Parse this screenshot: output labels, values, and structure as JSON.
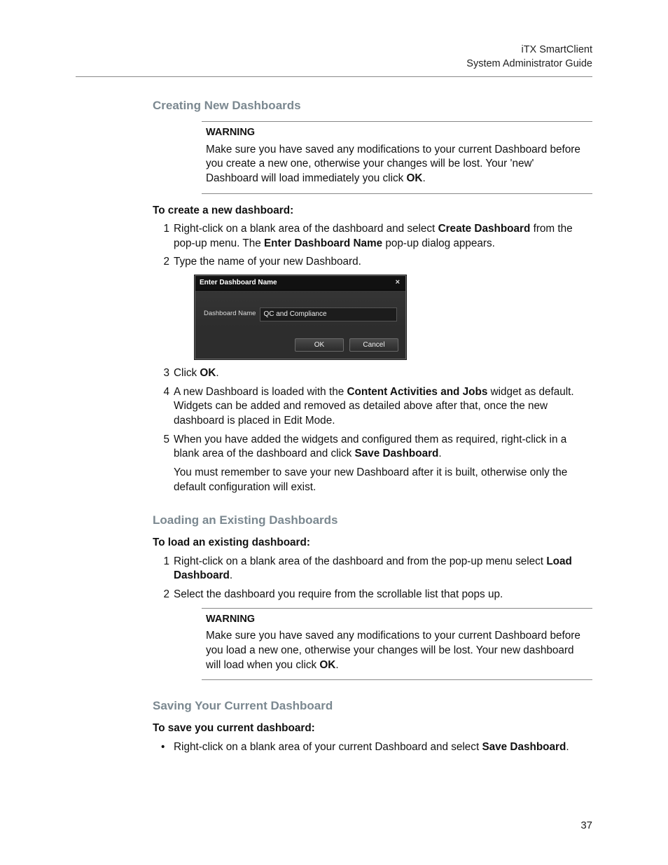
{
  "header": {
    "product": "iTX SmartClient",
    "doc": "System Administrator Guide"
  },
  "sections": {
    "creating": {
      "heading": "Creating New Dashboards",
      "warning_label": "WARNING",
      "warning_p1": "Make sure you have saved any modifications to your current Dashboard before you create a new one, otherwise your changes will be lost. Your 'new' Dashboard will load immediately you click ",
      "warning_ok": "OK",
      "warning_p1_tail": ".",
      "procedure_title": "To create a new dashboard:",
      "steps": {
        "s1a": "Right-click on a blank area of the dashboard and select ",
        "s1b": "Create Dashboard",
        "s1c": " from the pop-up menu. The ",
        "s1d": "Enter Dashboard Name",
        "s1e": " pop-up dialog appears.",
        "s2": "Type the name of your new Dashboard.",
        "s3a": "Click ",
        "s3b": "OK",
        "s3c": ".",
        "s4a": "A new Dashboard is loaded with the ",
        "s4b": "Content Activities and Jobs",
        "s4c": " widget as default. Widgets can be added and removed as detailed above after that, once the new dashboard is placed in Edit Mode.",
        "s5a": "When you have added the widgets and configured them as required, right-click in a blank area of the dashboard and click ",
        "s5b": "Save Dashboard",
        "s5c": ".",
        "s5extra": "You must remember to save your new Dashboard after it is built, otherwise only the default configuration will exist."
      }
    },
    "loading": {
      "heading": "Loading an Existing Dashboards",
      "procedure_title": "To load an existing dashboard:",
      "steps": {
        "s1a": "Right-click on a blank area of the dashboard and from the pop-up menu select ",
        "s1b": "Load Dashboard",
        "s1c": ".",
        "s2": "Select the dashboard you require from the scrollable list that pops up."
      },
      "warning_label": "WARNING",
      "warning_p1": "Make sure you have saved any modifications to your current Dashboard before you load a new one, otherwise your changes will be lost. Your new dashboard will load when you click ",
      "warning_ok": "OK",
      "warning_p1_tail": "."
    },
    "saving": {
      "heading": "Saving Your Current Dashboard",
      "procedure_title": "To save you current dashboard:",
      "b1a": "Right-click on a blank area of your current Dashboard and select ",
      "b1b": "Save Dashboard",
      "b1c": "."
    }
  },
  "dialog": {
    "title": "Enter Dashboard Name",
    "close": "×",
    "field_label": "Dashboard Name",
    "field_value": "QC and Compliance",
    "ok": "OK",
    "cancel": "Cancel"
  },
  "page_number": "37"
}
